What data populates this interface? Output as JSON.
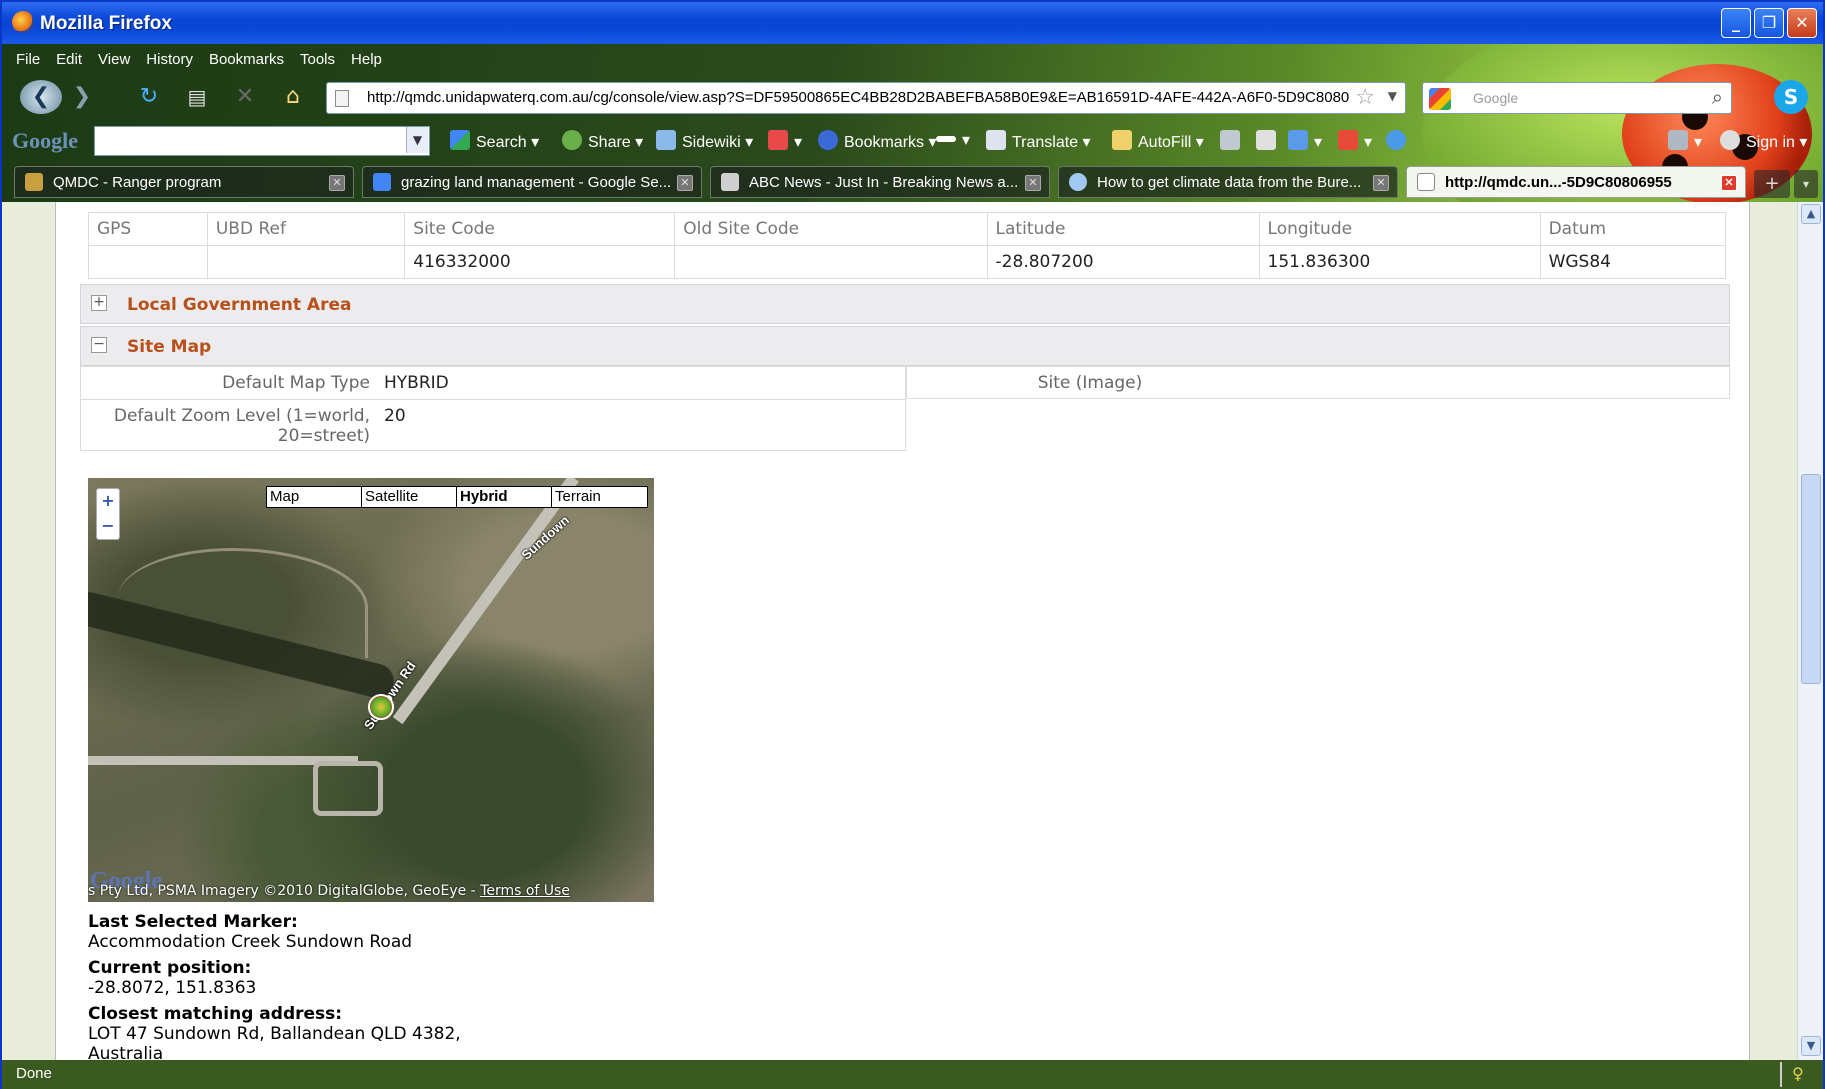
{
  "window": {
    "title": "Mozilla Firefox"
  },
  "menu": [
    "File",
    "Edit",
    "View",
    "History",
    "Bookmarks",
    "Tools",
    "Help"
  ],
  "address": {
    "url": "http://qmdc.unidapwaterq.com.au/cg/console/view.asp?S=DF59500865EC4BB28D2BABEFBA58B0E9&E=AB16591D-4AFE-442A-A6F0-5D9C8080"
  },
  "search": {
    "placeholder": "Google"
  },
  "google_toolbar": {
    "logo": "Google",
    "search_label": "Search",
    "share_label": "Share",
    "sidewiki_label": "Sidewiki",
    "bookmarks_label": "Bookmarks",
    "translate_label": "Translate",
    "autofill_label": "AutoFill",
    "signin_label": "Sign in"
  },
  "tabs": [
    {
      "label": "QMDC - Ranger program",
      "icon": "qmdc-icon",
      "color": "#c8a040"
    },
    {
      "label": "grazing land management - Google Se...",
      "icon": "google-icon",
      "color": "#4285f4"
    },
    {
      "label": "ABC News - Just In - Breaking News a...",
      "icon": "abc-icon",
      "color": "#cfcfcf"
    },
    {
      "label": "How to get climate data from the Bure...",
      "icon": "globe-icon",
      "color": "#a0c8f0"
    },
    {
      "label": "http://qmdc.un...-5D9C80806955",
      "icon": "page-icon",
      "color": "#ffffff",
      "active": true
    }
  ],
  "grid": {
    "headers": [
      "GPS",
      "UBD Ref",
      "Site Code",
      "Old Site Code",
      "Latitude",
      "Longitude",
      "Datum"
    ],
    "values": [
      "",
      "",
      "416332000",
      "",
      "-28.807200",
      "151.836300",
      "WGS84"
    ]
  },
  "sections": {
    "lga": {
      "toggle": "+",
      "title": "Local Government Area"
    },
    "sitemap": {
      "toggle": "−",
      "title": "Site Map"
    }
  },
  "sitemap": {
    "map_type_label": "Default Map Type",
    "map_type_value": "HYBRID",
    "site_image_label": "Site (Image)",
    "zoom_label_1": "Default Zoom Level (1=world,",
    "zoom_label_2": "20=street)",
    "zoom_value": "20"
  },
  "map": {
    "types": [
      "Map",
      "Satellite",
      "Hybrid",
      "Terrain"
    ],
    "selected_type": "Hybrid",
    "zoom_in": "+",
    "zoom_out": "−",
    "road_label_1": "Sundown",
    "road_label_2": "Sundown Rd",
    "logo": "Google",
    "attribution": "s Pty Ltd, PSMA Imagery ©2010 DigitalGlobe, GeoEye -",
    "terms": "Terms of Use"
  },
  "info": {
    "last_marker_label": "Last Selected Marker:",
    "last_marker_value": "Accommodation Creek Sundown Road",
    "current_position_label": "Current position:",
    "current_position_value": "-28.8072, 151.8363",
    "closest_address_label": "Closest matching address:",
    "closest_address_line1": "LOT 47 Sundown Rd, Ballandean QLD 4382,",
    "closest_address_line2": "Australia"
  },
  "status": {
    "text": "Done"
  },
  "colors": {
    "section_title": "#b8501a",
    "titlebar": "#0a46d8",
    "status": "#3a5a20"
  }
}
